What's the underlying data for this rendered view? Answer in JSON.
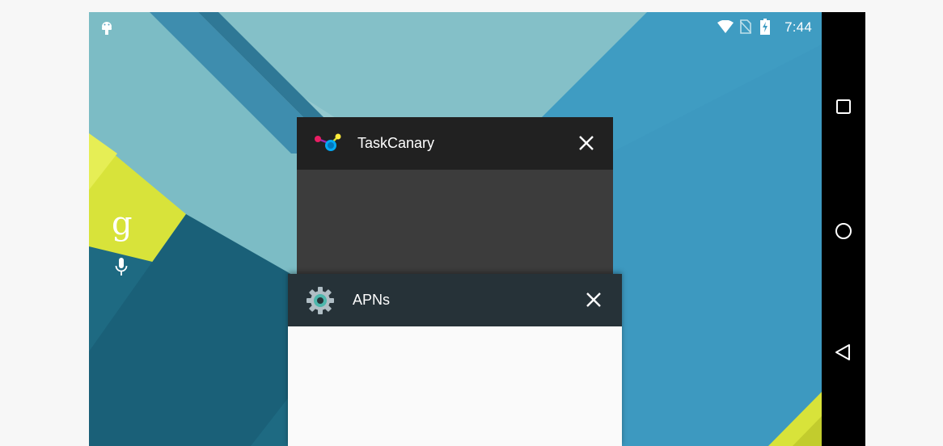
{
  "status_bar": {
    "time": "7:44",
    "icons": [
      "android-notification-icon",
      "wifi-icon",
      "no-sim-icon",
      "battery-charging-icon"
    ]
  },
  "home_screen": {
    "search_widget": {
      "google_letter": "g",
      "icons": [
        "google-g-icon",
        "mic-icon"
      ]
    }
  },
  "recents": {
    "cards": [
      {
        "title": "TaskCanary",
        "icon": "taskcanary-app-icon",
        "close_icon": "close-icon"
      },
      {
        "title": "APNs",
        "icon": "settings-gear-icon",
        "close_icon": "close-icon"
      }
    ]
  },
  "nav_bar": {
    "buttons": [
      "overview-square-icon",
      "home-circle-icon",
      "back-triangle-icon"
    ]
  },
  "colors": {
    "taskcanary_header": "#212121",
    "taskcanary_body": "#3c3c3c",
    "apns_header": "#263238",
    "apns_body": "#fafafa",
    "wallpaper_yellow": "#d8e33a",
    "wallpaper_teal": "#1e6a82",
    "wallpaper_light": "#83c2cc"
  }
}
